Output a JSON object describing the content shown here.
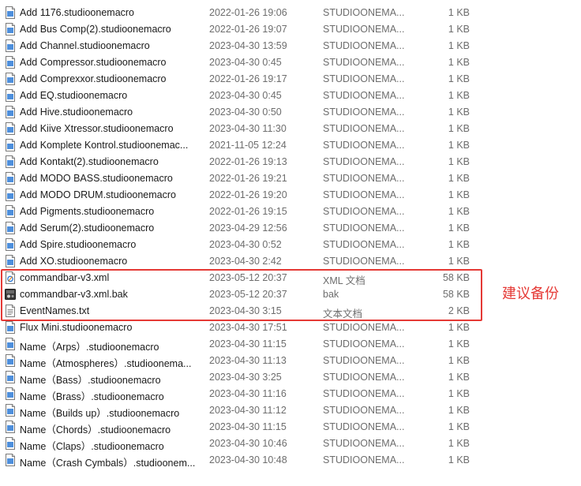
{
  "annotation": {
    "text": "建议备份",
    "color": "#e53935"
  },
  "files": [
    {
      "name": "Add 1176.studioonemacro",
      "date": "2022-01-26 19:06",
      "type": "STUDIOONEMA...",
      "size": "1 KB",
      "icon": "macro-file-icon"
    },
    {
      "name": "Add Bus Comp(2).studioonemacro",
      "date": "2022-01-26 19:07",
      "type": "STUDIOONEMA...",
      "size": "1 KB",
      "icon": "macro-file-icon"
    },
    {
      "name": "Add Channel.studioonemacro",
      "date": "2023-04-30 13:59",
      "type": "STUDIOONEMA...",
      "size": "1 KB",
      "icon": "macro-file-icon"
    },
    {
      "name": "Add Compressor.studioonemacro",
      "date": "2023-04-30 0:45",
      "type": "STUDIOONEMA...",
      "size": "1 KB",
      "icon": "macro-file-icon"
    },
    {
      "name": "Add Comprexxor.studioonemacro",
      "date": "2022-01-26 19:17",
      "type": "STUDIOONEMA...",
      "size": "1 KB",
      "icon": "macro-file-icon"
    },
    {
      "name": "Add EQ.studioonemacro",
      "date": "2023-04-30 0:45",
      "type": "STUDIOONEMA...",
      "size": "1 KB",
      "icon": "macro-file-icon"
    },
    {
      "name": "Add Hive.studioonemacro",
      "date": "2023-04-30 0:50",
      "type": "STUDIOONEMA...",
      "size": "1 KB",
      "icon": "macro-file-icon"
    },
    {
      "name": "Add Kiive Xtressor.studioonemacro",
      "date": "2023-04-30 11:30",
      "type": "STUDIOONEMA...",
      "size": "1 KB",
      "icon": "macro-file-icon"
    },
    {
      "name": "Add Komplete Kontrol.studioonemac...",
      "date": "2021-11-05 12:24",
      "type": "STUDIOONEMA...",
      "size": "1 KB",
      "icon": "macro-file-icon"
    },
    {
      "name": "Add Kontakt(2).studioonemacro",
      "date": "2022-01-26 19:13",
      "type": "STUDIOONEMA...",
      "size": "1 KB",
      "icon": "macro-file-icon"
    },
    {
      "name": "Add MODO BASS.studioonemacro",
      "date": "2022-01-26 19:21",
      "type": "STUDIOONEMA...",
      "size": "1 KB",
      "icon": "macro-file-icon"
    },
    {
      "name": "Add MODO DRUM.studioonemacro",
      "date": "2022-01-26 19:20",
      "type": "STUDIOONEMA...",
      "size": "1 KB",
      "icon": "macro-file-icon"
    },
    {
      "name": "Add Pigments.studioonemacro",
      "date": "2022-01-26 19:15",
      "type": "STUDIOONEMA...",
      "size": "1 KB",
      "icon": "macro-file-icon"
    },
    {
      "name": "Add Serum(2).studioonemacro",
      "date": "2023-04-29 12:56",
      "type": "STUDIOONEMA...",
      "size": "1 KB",
      "icon": "macro-file-icon"
    },
    {
      "name": "Add Spire.studioonemacro",
      "date": "2023-04-30 0:52",
      "type": "STUDIOONEMA...",
      "size": "1 KB",
      "icon": "macro-file-icon"
    },
    {
      "name": "Add XO.studioonemacro",
      "date": "2023-04-30 2:42",
      "type": "STUDIOONEMA...",
      "size": "1 KB",
      "icon": "macro-file-icon"
    },
    {
      "name": "commandbar-v3.xml",
      "date": "2023-05-12 20:37",
      "type": "XML 文档",
      "size": "58 KB",
      "icon": "xml-file-icon"
    },
    {
      "name": "commandbar-v3.xml.bak",
      "date": "2023-05-12 20:37",
      "type": "bak",
      "size": "58 KB",
      "icon": "bak-file-icon"
    },
    {
      "name": "EventNames.txt",
      "date": "2023-04-30 3:15",
      "type": "文本文档",
      "size": "2 KB",
      "icon": "text-file-icon"
    },
    {
      "name": "Flux Mini.studioonemacro",
      "date": "2023-04-30 17:51",
      "type": "STUDIOONEMA...",
      "size": "1 KB",
      "icon": "macro-file-icon"
    },
    {
      "name": "Name（Arps）.studioonemacro",
      "date": "2023-04-30 11:15",
      "type": "STUDIOONEMA...",
      "size": "1 KB",
      "icon": "macro-file-icon"
    },
    {
      "name": "Name（Atmospheres）.studioonema...",
      "date": "2023-04-30 11:13",
      "type": "STUDIOONEMA...",
      "size": "1 KB",
      "icon": "macro-file-icon"
    },
    {
      "name": "Name（Bass）.studioonemacro",
      "date": "2023-04-30 3:25",
      "type": "STUDIOONEMA...",
      "size": "1 KB",
      "icon": "macro-file-icon"
    },
    {
      "name": "Name（Brass）.studioonemacro",
      "date": "2023-04-30 11:16",
      "type": "STUDIOONEMA...",
      "size": "1 KB",
      "icon": "macro-file-icon"
    },
    {
      "name": "Name（Builds up）.studioonemacro",
      "date": "2023-04-30 11:12",
      "type": "STUDIOONEMA...",
      "size": "1 KB",
      "icon": "macro-file-icon"
    },
    {
      "name": "Name（Chords）.studioonemacro",
      "date": "2023-04-30 11:15",
      "type": "STUDIOONEMA...",
      "size": "1 KB",
      "icon": "macro-file-icon"
    },
    {
      "name": "Name（Claps）.studioonemacro",
      "date": "2023-04-30 10:46",
      "type": "STUDIOONEMA...",
      "size": "1 KB",
      "icon": "macro-file-icon"
    },
    {
      "name": "Name（Crash Cymbals）.studioonem...",
      "date": "2023-04-30 10:48",
      "type": "STUDIOONEMA...",
      "size": "1 KB",
      "icon": "macro-file-icon"
    }
  ]
}
